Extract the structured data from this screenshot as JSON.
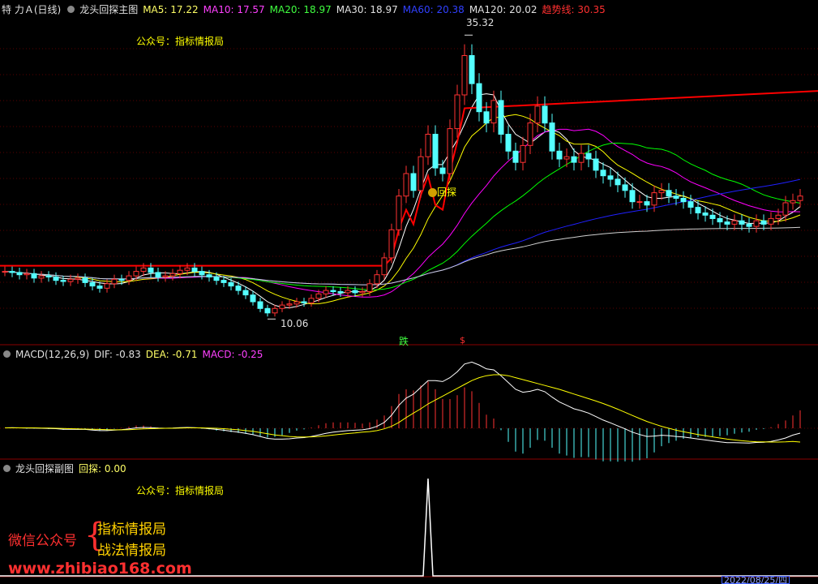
{
  "main_header": {
    "stock": "特 力Ａ(日线)",
    "indicator": "龙头回探主图",
    "ma5": "MA5: 17.22",
    "ma10": "MA10: 17.57",
    "ma20": "MA20: 18.97",
    "ma30": "MA30: 18.97",
    "ma60": "MA60: 20.38",
    "ma120": "MA120: 20.02",
    "trend": "趋势线: 30.35"
  },
  "macd_header": {
    "name": "MACD(12,26,9)",
    "dif": "DIF: -0.83",
    "dea": "DEA: -0.71",
    "macd": "MACD: -0.25"
  },
  "sub_header": {
    "name": "龙头回探副图",
    "value": "回探: 0.00"
  },
  "notes": {
    "gzh_main": "公众号：指标情报局",
    "gzh_sub": "公众号：指标情报局",
    "high_label": "35.32",
    "low_label": "10.06",
    "huitan_mark": "回探",
    "die_mark": "跌",
    "dollar_mark": "$"
  },
  "watermark": {
    "wechat": "微信公众号",
    "brace": "{",
    "line1": "指标情报局",
    "line2": "战法情报局",
    "site": "www.zhibiao168.com",
    "date": "2022/08/25/四"
  },
  "colors": {
    "up": "#ff3232",
    "down": "#54ffff",
    "ma5": "#ffffff",
    "ma10": "#ffff00",
    "ma20": "#ff00ff",
    "ma30": "#00ff00",
    "ma60": "#2020ff",
    "ma120": "#d0d0d0",
    "trend": "#ff0000"
  },
  "chart_data": {
    "type": "candlestick",
    "price_range": [
      9,
      37
    ],
    "high": 35.32,
    "low": 10.06,
    "trend_line": {
      "initial": 14.8,
      "final": 30.35
    },
    "closes": [
      14.3,
      14.2,
      14.0,
      14.1,
      13.7,
      13.9,
      13.8,
      13.5,
      13.4,
      13.6,
      13.7,
      13.3,
      13.0,
      12.8,
      13.2,
      13.6,
      13.5,
      13.9,
      14.3,
      14.6,
      14.2,
      13.8,
      13.9,
      14.1,
      14.4,
      14.6,
      14.3,
      14.0,
      13.8,
      13.5,
      13.3,
      13.0,
      12.6,
      12.2,
      11.6,
      11.0,
      10.6,
      11.0,
      11.3,
      11.4,
      11.6,
      11.5,
      11.9,
      12.3,
      12.6,
      12.5,
      12.4,
      12.6,
      12.4,
      12.5,
      13.2,
      14.0,
      15.5,
      18.0,
      21.0,
      23.0,
      21.5,
      24.5,
      26.5,
      23.5,
      23.0,
      27.0,
      30.0,
      33.5,
      31.0,
      28.5,
      27.5,
      29.5,
      26.5,
      25.0,
      24.0,
      25.5,
      27.5,
      29.0,
      27.5,
      25.0,
      24.3,
      24.5,
      24.0,
      24.8,
      24.3,
      23.3,
      22.8,
      22.5,
      22.0,
      21.5,
      20.5,
      20.5,
      20.2,
      21.3,
      21.5,
      21.0,
      20.8,
      20.5,
      20.0,
      19.5,
      19.3,
      19.0,
      18.7,
      18.5,
      18.8,
      18.5,
      18.3,
      18.8,
      18.5,
      19.0,
      19.3,
      20.4,
      20.6,
      21.0
    ],
    "macd": {
      "dif": [
        0.02,
        0.03,
        0.02,
        0.01,
        0.01,
        0.0,
        -0.01,
        -0.02,
        -0.05,
        -0.05,
        -0.06,
        -0.06,
        -0.09,
        -0.12,
        -0.12,
        -0.09,
        -0.07,
        -0.03,
        0.02,
        0.04,
        0.03,
        0.01,
        0.0,
        0.01,
        0.03,
        0.04,
        0.03,
        0.01,
        -0.02,
        -0.06,
        -0.1,
        -0.15,
        -0.2,
        -0.26,
        -0.33,
        -0.42,
        -0.52,
        -0.56,
        -0.56,
        -0.54,
        -0.5,
        -0.48,
        -0.42,
        -0.34,
        -0.26,
        -0.2,
        -0.16,
        -0.12,
        -0.1,
        -0.08,
        -0.02,
        0.1,
        0.3,
        0.67,
        1.18,
        1.55,
        1.75,
        2.1,
        2.45,
        2.45,
        2.4,
        2.6,
        2.9,
        3.3,
        3.4,
        3.25,
        3.05,
        3.0,
        2.7,
        2.35,
        2.0,
        1.85,
        1.9,
        2.0,
        1.88,
        1.6,
        1.35,
        1.18,
        1.0,
        0.9,
        0.78,
        0.6,
        0.42,
        0.28,
        0.12,
        -0.03,
        -0.2,
        -0.32,
        -0.42,
        -0.4,
        -0.36,
        -0.38,
        -0.42,
        -0.45,
        -0.5,
        -0.55,
        -0.6,
        -0.65,
        -0.7,
        -0.74,
        -0.74,
        -0.75,
        -0.76,
        -0.73,
        -0.72,
        -0.68,
        -0.6,
        -0.5,
        -0.35,
        -0.25
      ],
      "dea": [
        0.02,
        0.02,
        0.02,
        0.02,
        0.02,
        0.01,
        0.01,
        0.0,
        -0.01,
        -0.02,
        -0.03,
        -0.04,
        -0.05,
        -0.06,
        -0.07,
        -0.08,
        -0.08,
        -0.07,
        -0.05,
        -0.03,
        -0.02,
        -0.01,
        0.0,
        0.0,
        0.01,
        0.02,
        0.02,
        0.02,
        0.01,
        0.0,
        -0.02,
        -0.05,
        -0.08,
        -0.12,
        -0.16,
        -0.22,
        -0.28,
        -0.34,
        -0.38,
        -0.42,
        -0.44,
        -0.45,
        -0.44,
        -0.42,
        -0.39,
        -0.35,
        -0.31,
        -0.27,
        -0.24,
        -0.2,
        -0.17,
        -0.12,
        -0.03,
        0.1,
        0.3,
        0.55,
        0.78,
        1.0,
        1.25,
        1.45,
        1.65,
        1.85,
        2.05,
        2.25,
        2.45,
        2.6,
        2.7,
        2.75,
        2.75,
        2.7,
        2.6,
        2.5,
        2.4,
        2.3,
        2.2,
        2.1,
        2.0,
        1.88,
        1.76,
        1.64,
        1.52,
        1.4,
        1.27,
        1.13,
        0.98,
        0.82,
        0.66,
        0.5,
        0.35,
        0.22,
        0.1,
        0.0,
        -0.1,
        -0.18,
        -0.25,
        -0.32,
        -0.38,
        -0.44,
        -0.5,
        -0.56,
        -0.6,
        -0.64,
        -0.67,
        -0.69,
        -0.7,
        -0.71,
        -0.71,
        -0.7,
        -0.68,
        -0.71
      ]
    },
    "huitan": {
      "spike_index": 58,
      "spike_value": 1.0,
      "baseline": 0.0
    }
  }
}
